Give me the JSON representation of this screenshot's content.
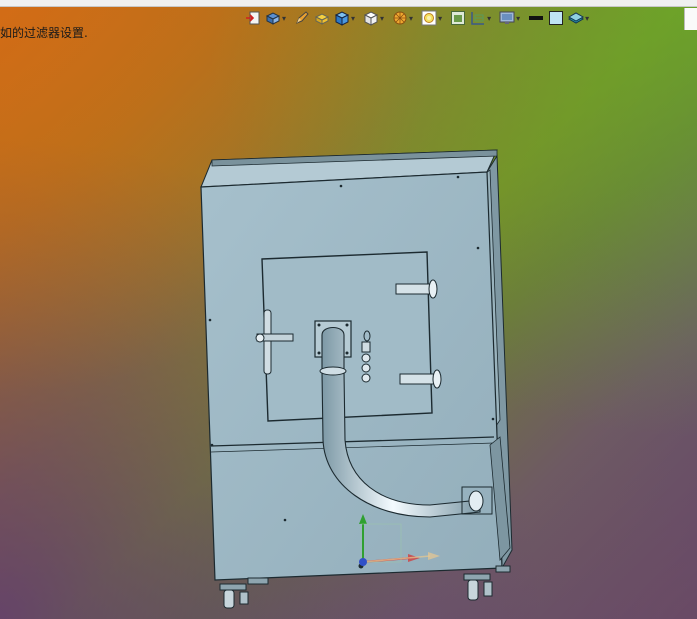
{
  "caption": "如的过滤器设置.",
  "toolbar": {
    "items": [
      {
        "icon": "door-exit-icon",
        "dropdown": false
      },
      {
        "icon": "view-orientation-icon",
        "dropdown": true
      },
      {
        "icon": "pencil-sketch-icon",
        "dropdown": false
      },
      {
        "icon": "part-yellow-icon",
        "dropdown": false
      },
      {
        "icon": "cube-blue-icon",
        "dropdown": true
      },
      {
        "icon": "cube-white-icon",
        "dropdown": true
      },
      {
        "icon": "section-view-icon",
        "dropdown": true
      },
      {
        "icon": "appearance-icon",
        "dropdown": true
      },
      {
        "icon": "scene-icon",
        "dropdown": false
      },
      {
        "icon": "display-style-icon",
        "dropdown": true
      },
      {
        "icon": "monitor-icon",
        "dropdown": true
      },
      {
        "icon": "line-color-icon",
        "dropdown": false
      },
      {
        "icon": "background-swatch-icon",
        "dropdown": false
      },
      {
        "icon": "layers-icon",
        "dropdown": true
      }
    ]
  },
  "colors": {
    "model_face": "#9db8c4",
    "model_edge": "#1c2a30",
    "triad_x": "#d04040",
    "triad_y": "#30a030"
  }
}
